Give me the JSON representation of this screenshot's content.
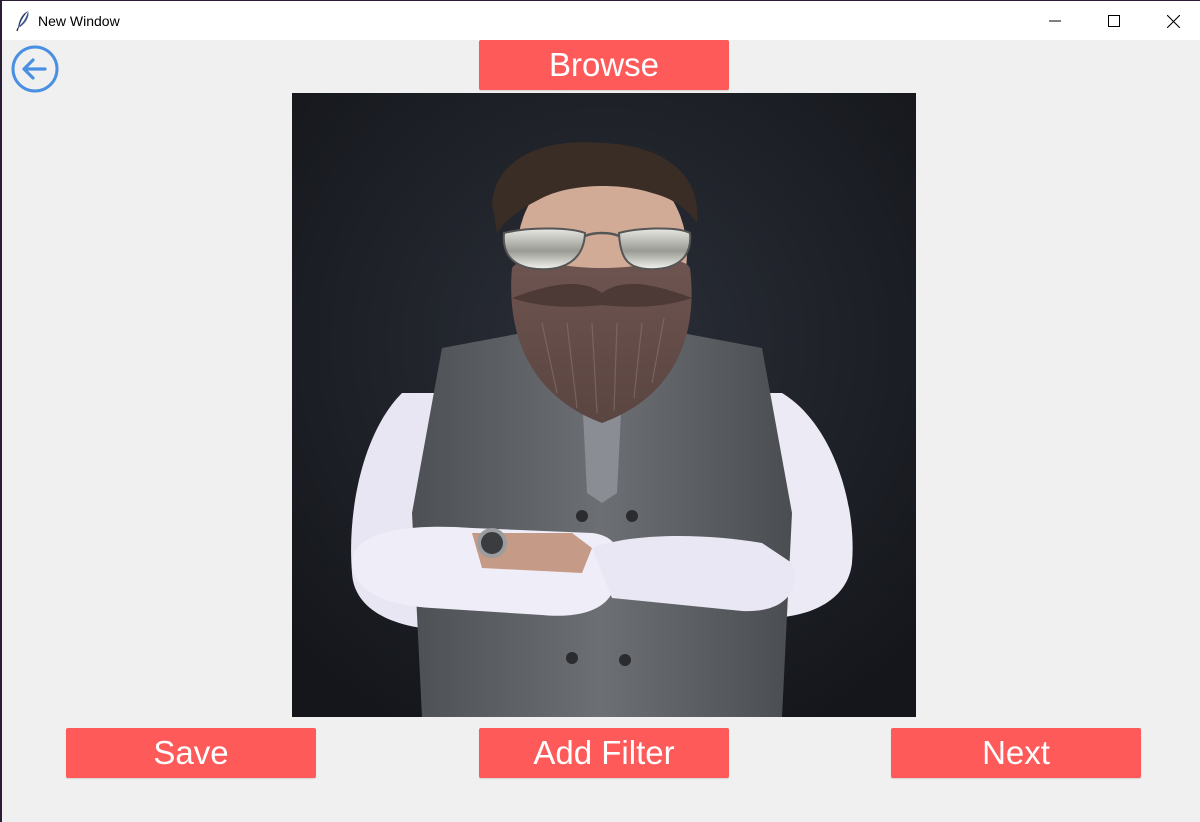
{
  "window": {
    "title": "New Window",
    "controls": [
      "minimize",
      "maximize",
      "close"
    ]
  },
  "toolbar": {
    "back_icon": "back-arrow-icon",
    "browse_label": "Browse"
  },
  "preview": {
    "image_description_icon": "photo-man-with-beard-and-sunglasses-filter"
  },
  "actions": {
    "save_label": "Save",
    "add_filter_label": "Add Filter",
    "next_label": "Next"
  },
  "colors": {
    "button_bg": "#ff5a5a",
    "button_text": "#ffffff",
    "window_bg": "#f0f0f0",
    "back_icon": "#4a90e2"
  }
}
